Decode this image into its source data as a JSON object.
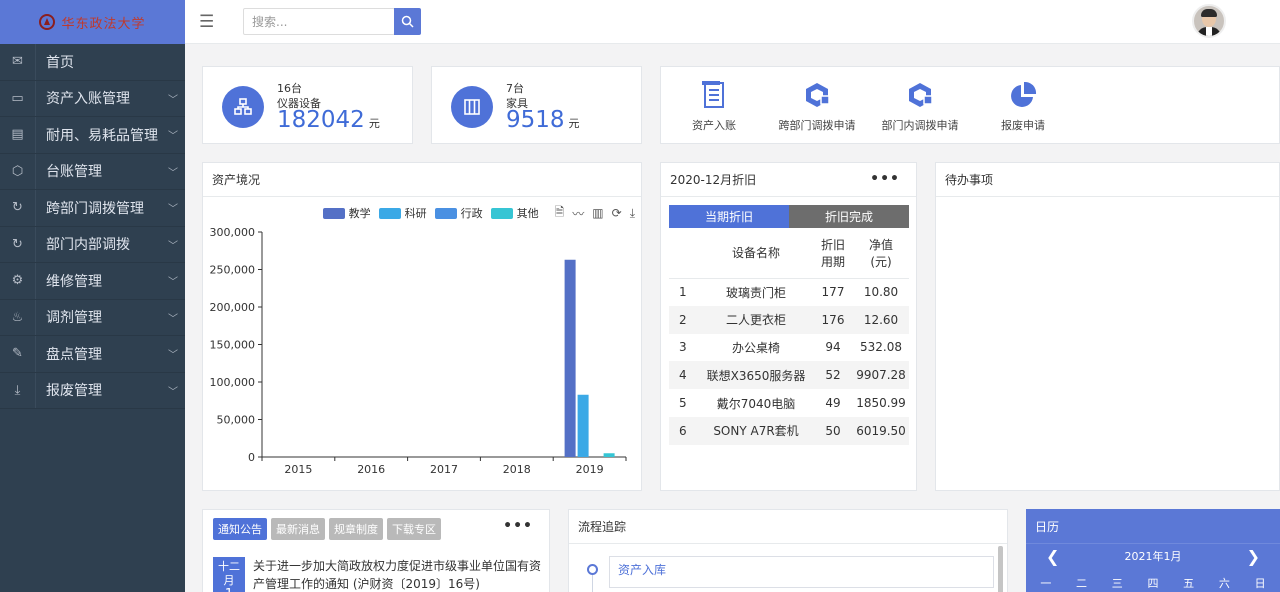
{
  "sidebar": {
    "logo_text": "华东政法大学",
    "items": [
      {
        "label": "首页",
        "icon": "home-icon",
        "chevron": false
      },
      {
        "label": "资产入账管理",
        "icon": "monitor-icon",
        "chevron": true
      },
      {
        "label": "耐用、易耗品管理",
        "icon": "box-icon",
        "chevron": true
      },
      {
        "label": "台账管理",
        "icon": "cube-icon",
        "chevron": true
      },
      {
        "label": "跨部门调拨管理",
        "icon": "refresh-icon",
        "chevron": true
      },
      {
        "label": "部门内部调拨",
        "icon": "refresh-icon",
        "chevron": true
      },
      {
        "label": "维修管理",
        "icon": "gear-icon",
        "chevron": true
      },
      {
        "label": "调剂管理",
        "icon": "handshake-icon",
        "chevron": true
      },
      {
        "label": "盘点管理",
        "icon": "clipboard-icon",
        "chevron": true
      },
      {
        "label": "报废管理",
        "icon": "download-icon",
        "chevron": true
      }
    ]
  },
  "topbar": {
    "search_placeholder": "搜索..."
  },
  "stats": [
    {
      "count": "16台",
      "name": "仪器设备",
      "value": "182042",
      "unit": "元",
      "icon": "instrument-icon"
    },
    {
      "count": "7台",
      "name": "家具",
      "value": "9518",
      "unit": "元",
      "icon": "furniture-icon"
    }
  ],
  "quick_actions": [
    {
      "label": "资产入账",
      "icon": "ledger-icon"
    },
    {
      "label": "跨部门调拨申请",
      "icon": "transfer-icon"
    },
    {
      "label": "部门内调拨申请",
      "icon": "internal-transfer-icon"
    },
    {
      "label": "报废申请",
      "icon": "pie-icon"
    }
  ],
  "assets_panel": {
    "title": "资产境况"
  },
  "chart_data": {
    "type": "bar",
    "categories": [
      "2015",
      "2016",
      "2017",
      "2018",
      "2019"
    ],
    "series": [
      {
        "name": "教学",
        "color": "#5470c6",
        "values": [
          0,
          0,
          0,
          0,
          263000
        ]
      },
      {
        "name": "科研",
        "color": "#3ba9e6",
        "values": [
          0,
          0,
          0,
          0,
          83000
        ]
      },
      {
        "name": "行政",
        "color": "#4a90e2",
        "values": [
          0,
          0,
          0,
          0,
          0
        ]
      },
      {
        "name": "其他",
        "color": "#36c5d4",
        "values": [
          0,
          0,
          0,
          0,
          5000
        ]
      }
    ],
    "ylim": [
      0,
      300000
    ],
    "yticks": [
      "0",
      "50,000",
      "100,000",
      "150,000",
      "200,000",
      "250,000",
      "300,000"
    ],
    "legend_position": "top-right"
  },
  "depreciation": {
    "title": "2020-12月折旧",
    "tab_current": "当期折旧",
    "tab_done": "折旧完成",
    "col_name": "设备名称",
    "col_period": [
      "折旧",
      "用期"
    ],
    "col_net": [
      "净值",
      "(元)"
    ],
    "rows": [
      {
        "idx": "1",
        "name": "玻璃责门柜",
        "period": "177",
        "net": "10.80"
      },
      {
        "idx": "2",
        "name": "二人更衣柜",
        "period": "176",
        "net": "12.60"
      },
      {
        "idx": "3",
        "name": "办公桌椅",
        "period": "94",
        "net": "532.08"
      },
      {
        "idx": "4",
        "name": "联想X3650服务器",
        "period": "52",
        "net": "9907.28"
      },
      {
        "idx": "5",
        "name": "戴尔7040电脑",
        "period": "49",
        "net": "1850.99"
      },
      {
        "idx": "6",
        "name": "SONY A7R套机",
        "period": "50",
        "net": "6019.50"
      }
    ]
  },
  "todo": {
    "title": "待办事项"
  },
  "notices": {
    "tabs": [
      "通知公告",
      "最新消息",
      "规章制度",
      "下载专区"
    ],
    "month": "十二月",
    "day": "1",
    "text": "关于进一步加大简政放权力度促进市级事业单位国有资产管理工作的通知 (沪财资〔2019〕16号)"
  },
  "flow": {
    "title": "流程追踪",
    "first_step": "资产入库"
  },
  "calendar": {
    "title": "日历",
    "month": "2021年1月",
    "weekdays": [
      "一",
      "二",
      "三",
      "四",
      "五",
      "六",
      "日"
    ]
  }
}
